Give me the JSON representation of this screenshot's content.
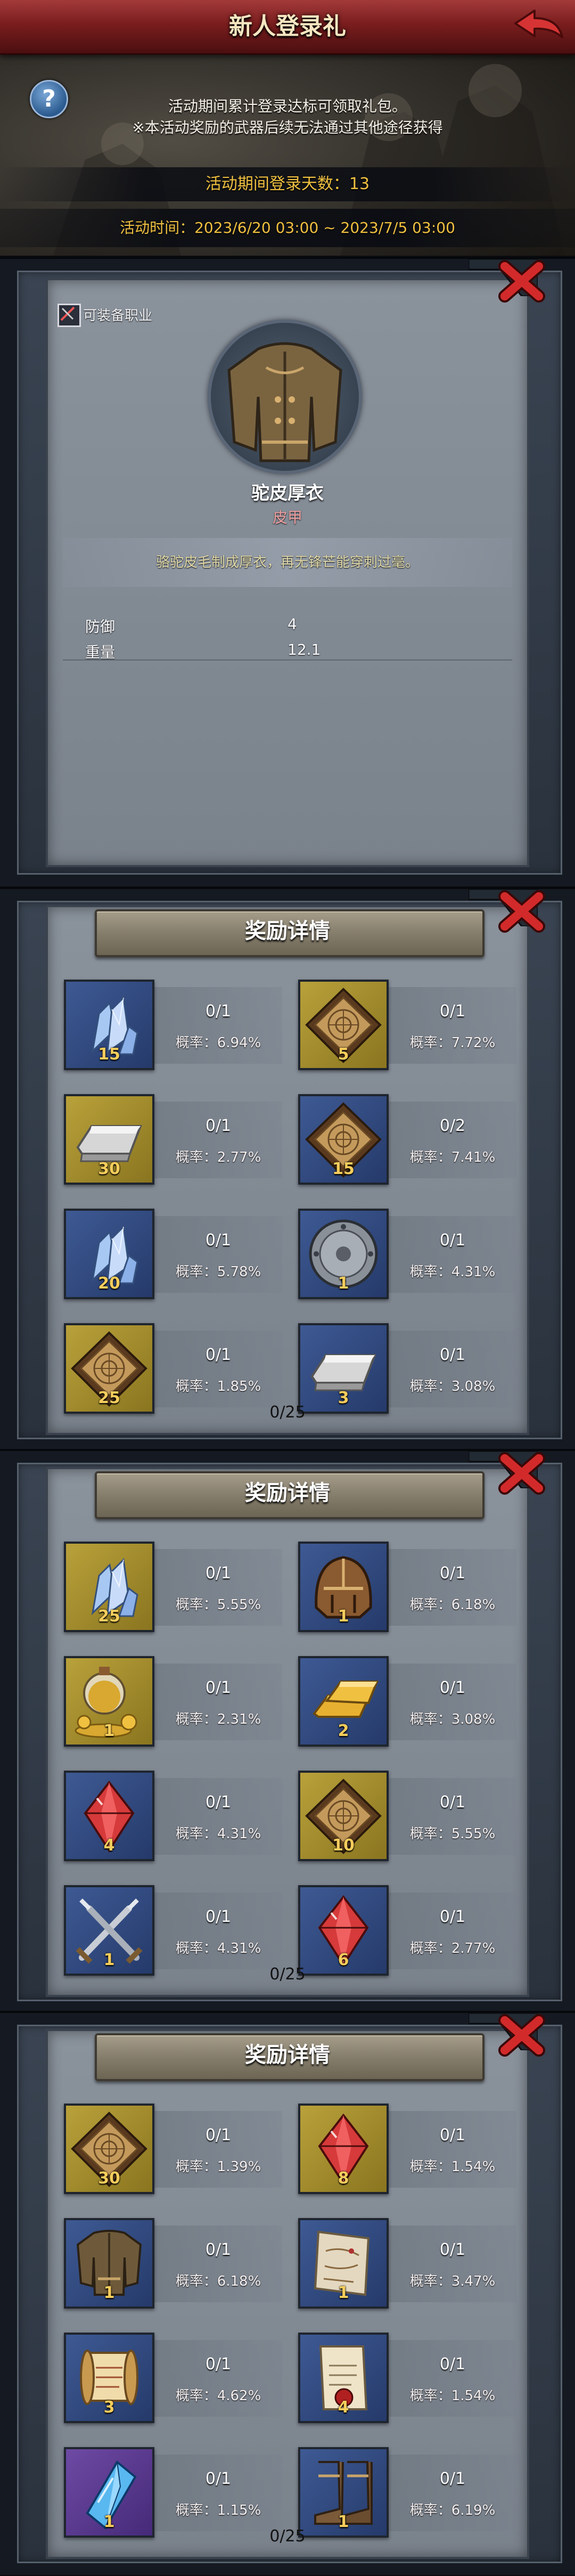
{
  "header": {
    "title": "新人登录礼",
    "line1": "活动期间累计登录达标可领取礼包。",
    "line2": "※本活动奖励的武器后续无法通过其他途径获得",
    "login_days_label": "活动期间登录天数：13",
    "time_label": "活动时间：2023/6/20 03:00 ~ 2023/7/5 03:00"
  },
  "item_detail": {
    "equip_tag": "可装备职业",
    "name": "驼皮厚衣",
    "type": "皮甲",
    "description": "骆驼皮毛制成厚衣，再无锋芒能穿刺过毫。",
    "stats": [
      {
        "label": "防御",
        "value": "4"
      },
      {
        "label": "重量",
        "value": "12.1"
      }
    ]
  },
  "reward_panels": [
    {
      "title": "奖励详情",
      "total": "0/25",
      "items": [
        {
          "icon": "blue-crystal-icon",
          "quality": "blue",
          "qty": "15",
          "progress": "0/1",
          "prob": "概率：6.94%"
        },
        {
          "icon": "rune-tablet-icon",
          "quality": "yellow",
          "qty": "5",
          "progress": "0/1",
          "prob": "概率：7.72%"
        },
        {
          "icon": "silver-ingot-icon",
          "quality": "yellow",
          "qty": "30",
          "progress": "0/1",
          "prob": "概率：2.77%"
        },
        {
          "icon": "rune-tablet-icon",
          "quality": "blue",
          "qty": "15",
          "progress": "0/2",
          "prob": "概率：7.41%"
        },
        {
          "icon": "blue-crystal-icon",
          "quality": "blue",
          "qty": "20",
          "progress": "0/1",
          "prob": "概率：5.78%"
        },
        {
          "icon": "round-shield-icon",
          "quality": "blue",
          "qty": "1",
          "progress": "0/1",
          "prob": "概率：4.31%"
        },
        {
          "icon": "rune-tablet-icon",
          "quality": "yellow",
          "qty": "25",
          "progress": "0/1",
          "prob": "概率：1.85%"
        },
        {
          "icon": "silver-ingot-icon",
          "quality": "blue",
          "qty": "3",
          "progress": "0/1",
          "prob": "概率：3.08%"
        }
      ]
    },
    {
      "title": "奖励详情",
      "total": "0/25",
      "items": [
        {
          "icon": "blue-crystal-icon",
          "quality": "yellow",
          "qty": "25",
          "progress": "0/1",
          "prob": "概率：5.55%"
        },
        {
          "icon": "leather-helmet-icon",
          "quality": "blue",
          "qty": "1",
          "progress": "0/1",
          "prob": "概率：6.18%"
        },
        {
          "icon": "potion-coins-icon",
          "quality": "yellow",
          "qty": "1",
          "progress": "0/1",
          "prob": "概率：2.31%"
        },
        {
          "icon": "gold-bars-icon",
          "quality": "blue",
          "qty": "2",
          "progress": "0/1",
          "prob": "概率：3.08%"
        },
        {
          "icon": "red-gem-icon",
          "quality": "blue",
          "qty": "4",
          "progress": "0/1",
          "prob": "概率：4.31%"
        },
        {
          "icon": "rune-tablet-icon",
          "quality": "yellow",
          "qty": "10",
          "progress": "0/1",
          "prob": "概率：5.55%"
        },
        {
          "icon": "crossed-swords-icon",
          "quality": "blue",
          "qty": "1",
          "progress": "0/1",
          "prob": "概率：4.31%"
        },
        {
          "icon": "red-gem-icon",
          "quality": "blue",
          "qty": "6",
          "progress": "0/1",
          "prob": "概率：2.77%"
        }
      ]
    },
    {
      "title": "奖励详情",
      "total": "0/25",
      "items": [
        {
          "icon": "rune-tablet-icon",
          "quality": "yellow",
          "qty": "30",
          "progress": "0/1",
          "prob": "概率：1.39%"
        },
        {
          "icon": "red-gem-icon",
          "quality": "yellow",
          "qty": "8",
          "progress": "0/1",
          "prob": "概率：1.54%"
        },
        {
          "icon": "leather-armor-icon",
          "quality": "blue",
          "qty": "1",
          "progress": "0/1",
          "prob": "概率：6.18%"
        },
        {
          "icon": "map-scroll-icon",
          "quality": "blue",
          "qty": "1",
          "progress": "0/1",
          "prob": "概率：3.47%"
        },
        {
          "icon": "scroll-icon",
          "quality": "blue",
          "qty": "3",
          "progress": "0/1",
          "prob": "概率：4.62%"
        },
        {
          "icon": "sealed-letter-icon",
          "quality": "blue",
          "qty": "4",
          "progress": "0/1",
          "prob": "概率：1.54%"
        },
        {
          "icon": "blue-shard-icon",
          "quality": "purple",
          "qty": "1",
          "progress": "0/1",
          "prob": "概率：1.15%"
        },
        {
          "icon": "leather-boots-icon",
          "quality": "blue",
          "qty": "1",
          "progress": "0/1",
          "prob": "概率：6.19%"
        }
      ]
    }
  ]
}
